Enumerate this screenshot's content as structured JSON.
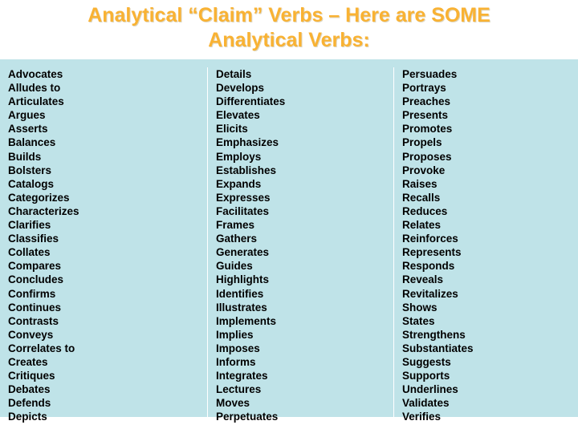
{
  "slide": {
    "title_line1_part1": "Analytical “Claim” Verbs – Here are ",
    "title_line1_part2": "SOME",
    "title_line2": "Analytical Verbs:",
    "colors": {
      "title_text": "#f9b233",
      "body_background": "#bfe3e8",
      "slide_background": "#ffffff",
      "body_text": "#000000",
      "divider": "#ffffff"
    },
    "columns": [
      {
        "items": [
          "Advocates",
          "Alludes to",
          "Articulates",
          "Argues",
          "Asserts",
          "Balances",
          "Builds",
          "Bolsters",
          "Catalogs",
          "Categorizes",
          "Characterizes",
          "Clarifies",
          "Classifies",
          "Collates",
          "Compares",
          "Concludes",
          "Confirms",
          "Continues",
          "Contrasts",
          "Conveys",
          "Correlates to",
          "Creates",
          "Critiques",
          "Debates",
          "Defends",
          "Depicts"
        ]
      },
      {
        "items": [
          "Details",
          "Develops",
          "Differentiates",
          "Elevates",
          "Elicits",
          "Emphasizes",
          "Employs",
          "Establishes",
          "Expands",
          "Expresses",
          "Facilitates",
          "Frames",
          "Gathers",
          "Generates",
          "Guides",
          "Highlights",
          "Identifies",
          "Illustrates",
          "Implements",
          "Implies",
          "Imposes",
          "Informs",
          "Integrates",
          "Lectures",
          "Moves",
          "Perpetuates"
        ]
      },
      {
        "items": [
          "Persuades",
          "Portrays",
          "Preaches",
          "Presents",
          "Promotes",
          "Propels",
          "Proposes",
          "Provoke",
          "Raises",
          "Recalls",
          "Reduces",
          "Relates",
          "Reinforces",
          "Represents",
          "Responds",
          "Reveals",
          "Revitalizes",
          "Shows",
          "States",
          "Strengthens",
          "Substantiates",
          "Suggests",
          "Supports",
          "Underlines",
          "Validates",
          "Verifies"
        ]
      }
    ]
  }
}
